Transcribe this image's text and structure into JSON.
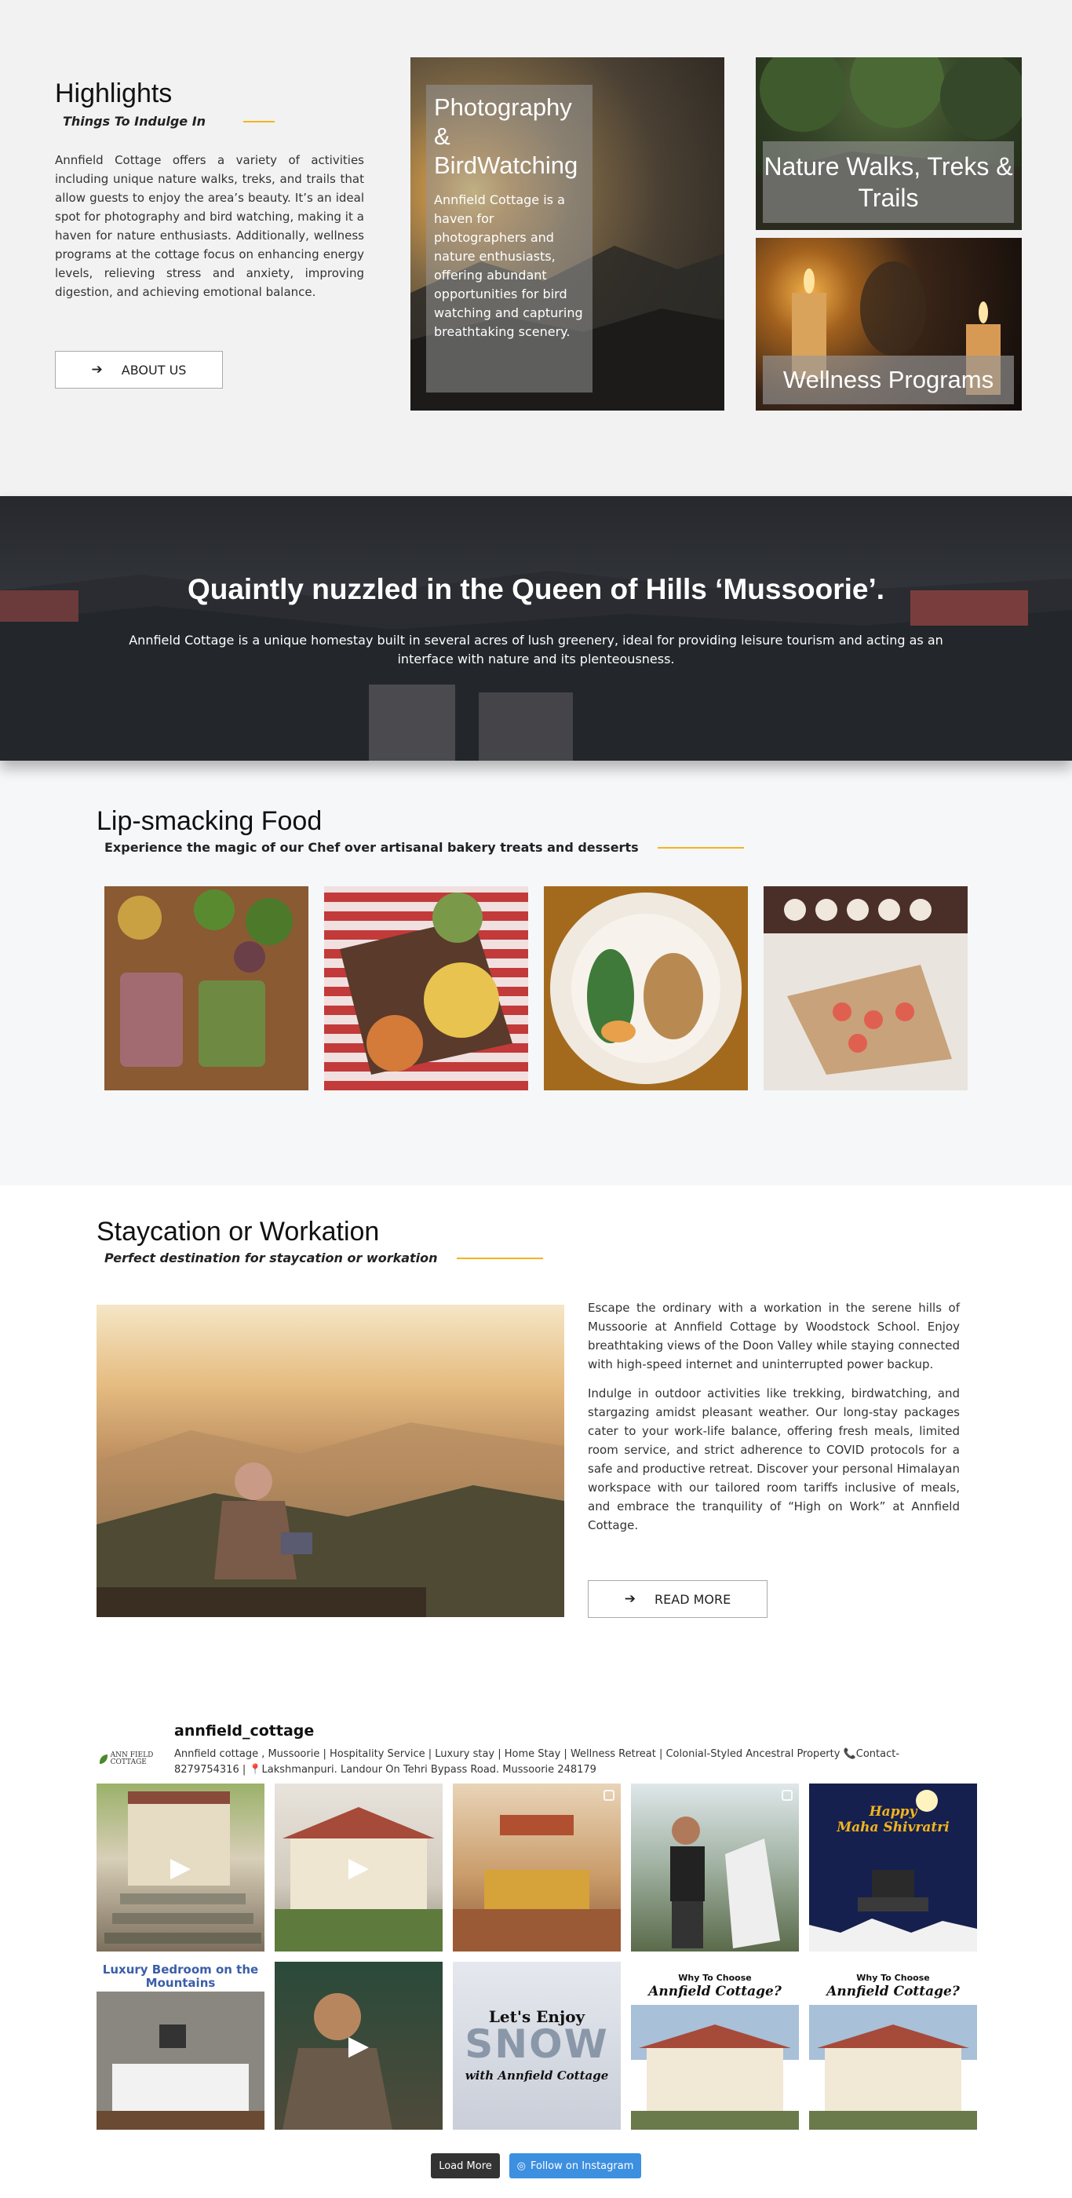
{
  "highlights": {
    "title": "Highlights",
    "subtitle": "Things To Indulge In",
    "text": "Annfield Cottage offers a variety of activities including unique nature walks, treks, and trails that allow guests to enjoy the area’s beauty. It’s an ideal spot for photography and bird watching, making it a haven for nature enthusiasts. Additionally, wellness programs at the cottage focus on enhancing energy levels, relieving stress and anxiety, improving digestion, and achieving emotional balance.",
    "button": "ABOUT US",
    "cards": [
      {
        "title": "Photography & BirdWatching",
        "text": "Annfield Cottage is a haven for photographers and nature enthusiasts, offering abundant opportunities for bird watching and capturing breathtaking scenery."
      },
      {
        "title": "Nature Walks, Treks & Trails"
      },
      {
        "title": "Wellness Programs"
      }
    ]
  },
  "banner": {
    "title": "Quaintly nuzzled in the Queen of Hills ‘Mussoorie’.",
    "text": "Annfield Cottage is a unique homestay built in several acres of lush greenery, ideal for providing leisure tourism and acting as an interface with nature and its plenteousness."
  },
  "food": {
    "title": "Lip-smacking Food",
    "subtitle": "Experience the magic of our Chef over artisanal bakery treats and desserts"
  },
  "stay": {
    "title": "Staycation or Workation",
    "subtitle": "Perfect destination for staycation or workation",
    "p1": "Escape the ordinary with a workation in the serene hills of Mussoorie at Annfield Cottage by Woodstock School. Enjoy breathtaking views of the Doon Valley while staying connected with high-speed internet and uninterrupted power backup.",
    "p2": "Indulge in outdoor activities like trekking, birdwatching, and stargazing amidst pleasant weather. Our long-stay packages cater to your work-life balance, offering fresh meals, limited room service, and strict adherence to COVID protocols for a safe and productive retreat. Discover your personal Himalayan workspace with our tailored room tariffs inclusive of meals, and embrace the tranquility of “High on Work” at Annfield Cottage.",
    "button": "READ MORE"
  },
  "instagram": {
    "logo_text": "ANN FIELD COTTAGE",
    "username": "annfield_cottage",
    "bio": "Annfield cottage , Mussoorie | Hospitality Service | Luxury stay | Home Stay | Wellness Retreat | Colonial-Styled Ancestral Property 📞Contact- 8279754316 | 📍Lakshmanpuri. Landour On Tehri Bypass Road. Mussoorie 248179",
    "tiles": {
      "shivratri_1": "Happy",
      "shivratri_2": "Maha Shivratri",
      "bedroom": "Luxury Bedroom on the Mountains",
      "enjoy": "Let's Enjoy",
      "snow": "SNOW",
      "with": "with Annfield Cottage",
      "why": "Why To Choose",
      "annfield": "Annfield Cottage?"
    },
    "load_more": "Load More",
    "follow": "Follow on Instagram"
  }
}
